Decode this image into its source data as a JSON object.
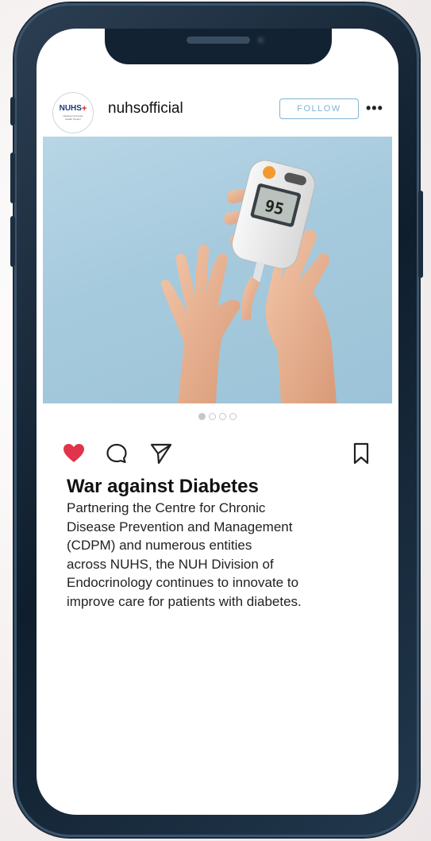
{
  "post": {
    "account": {
      "avatar_logo": "NUHS",
      "avatar_subtitle": "National University Health System",
      "username": "nuhsofficial",
      "follow_label": "FOLLOW",
      "more_label": "•••"
    },
    "carousel": {
      "total_slides": 4,
      "active_slide": 1
    },
    "actions": {
      "like_icon": "heart-filled-icon",
      "comment_icon": "comment-icon",
      "share_icon": "send-icon",
      "save_icon": "bookmark-icon",
      "liked": true
    },
    "caption": {
      "title": "War against Diabetes",
      "body": "Partnering the Centre for Chronic\nDisease Prevention and Management\n(CDPM) and numerous entities\nacross NUHS, the NUH Division of\nEndocrinology continues to innovate to\nimprove care for patients with diabetes."
    },
    "glucometer_reading": "95"
  },
  "colors": {
    "phone_frame": "#0f1e2d",
    "like_red": "#e0344a",
    "follow_blue": "#7fb3d6",
    "photo_bg": "#a6cadd"
  }
}
